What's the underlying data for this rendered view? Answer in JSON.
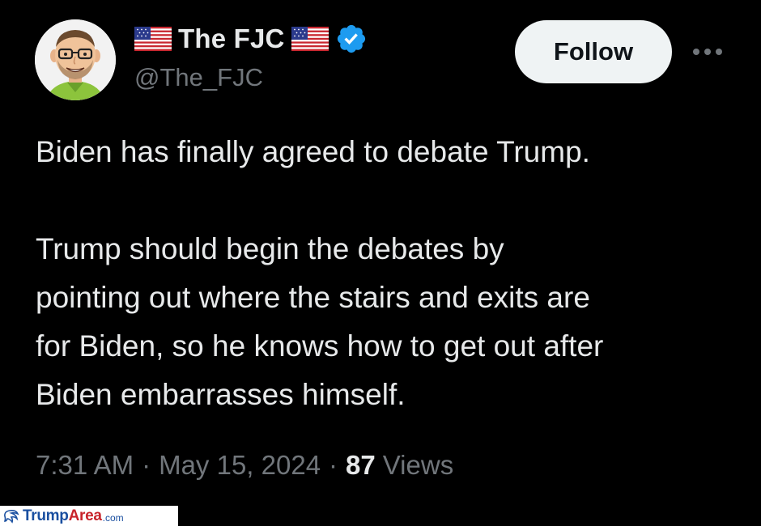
{
  "author": {
    "display_name": "The FJC",
    "handle": "@The_FJC",
    "verified": true,
    "name_decorations": [
      "us-flag-icon",
      "us-flag-icon"
    ]
  },
  "actions": {
    "follow_label": "Follow",
    "more_icon": "more-horizontal-icon"
  },
  "tweet": {
    "paragraph1": "Biden has finally agreed to debate Trump.",
    "paragraph2_lines": [
      "Trump should begin the debates by",
      "pointing out where the stairs and exits are",
      "for Biden, so he knows how to get out after",
      "Biden embarrasses himself."
    ]
  },
  "meta": {
    "time": "7:31 AM",
    "separator": "·",
    "date": "May 15, 2024",
    "views_count": "87",
    "views_label": "Views"
  },
  "watermark": {
    "brand_part1": "Trump",
    "brand_part2": "Area",
    "brand_suffix": ".com"
  },
  "colors": {
    "background": "#000000",
    "text_primary": "#e7e9ea",
    "text_secondary": "#71767b",
    "follow_bg": "#eff3f4",
    "verified_blue": "#1d9bf0"
  }
}
